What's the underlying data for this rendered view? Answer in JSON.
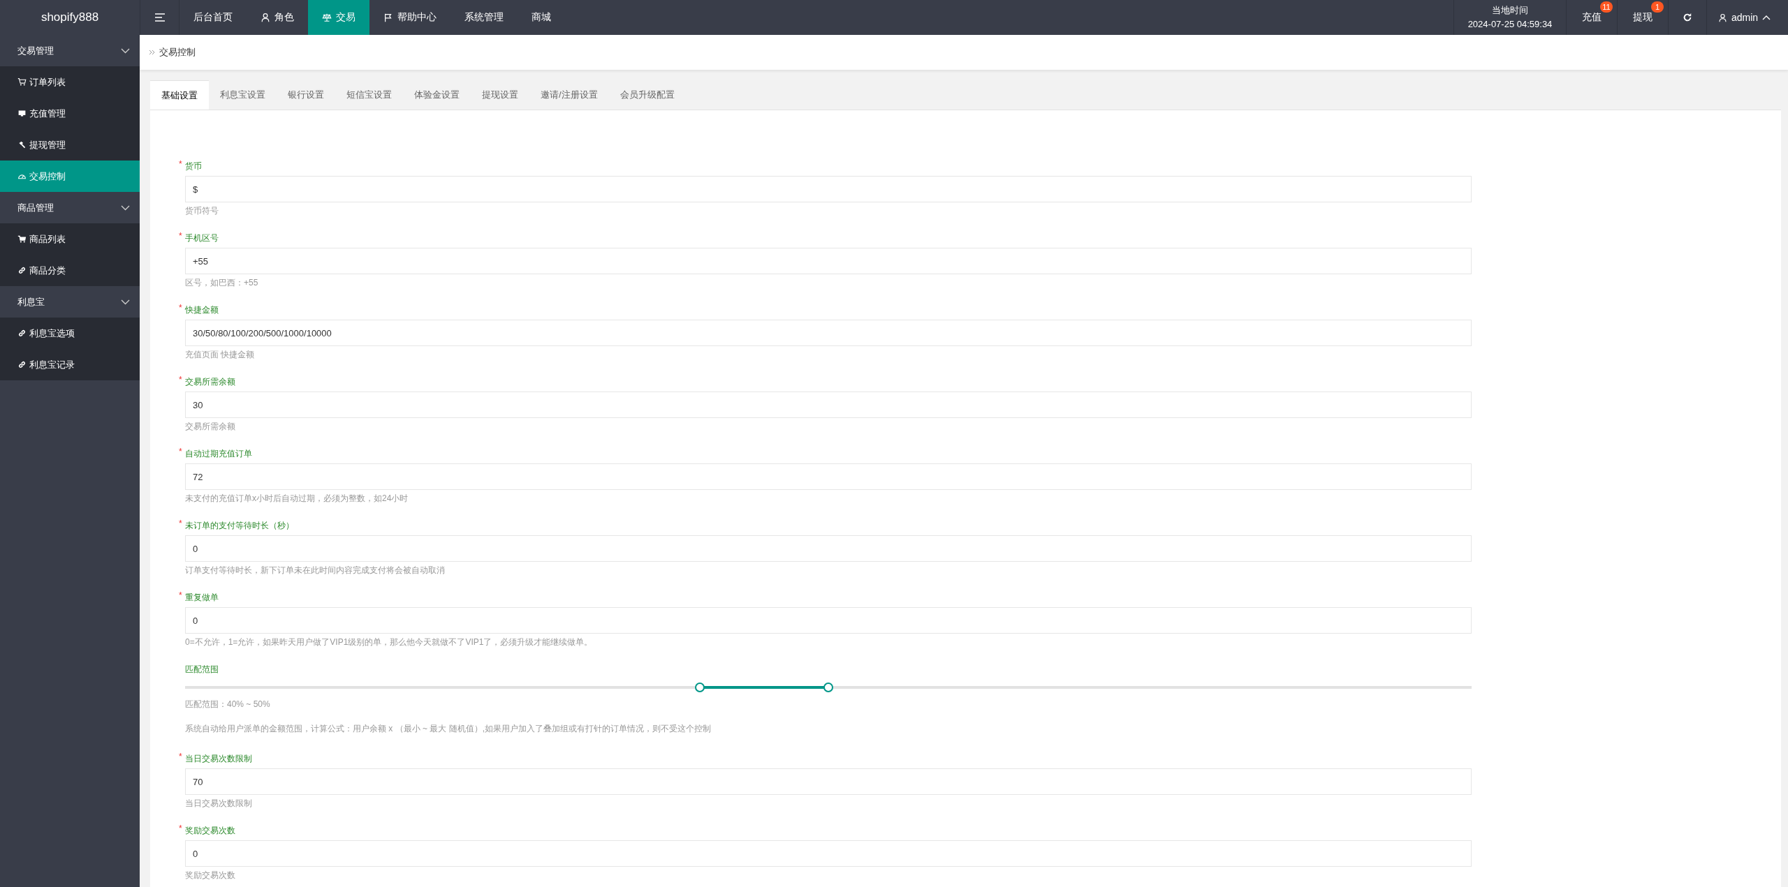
{
  "topbar": {
    "logo": "shopify888",
    "nav": [
      {
        "label": "后台首页",
        "selected": false
      },
      {
        "label": "角色",
        "selected": false
      },
      {
        "label": "交易",
        "selected": true
      },
      {
        "label": "帮助中心",
        "selected": false
      },
      {
        "label": "系统管理",
        "selected": false
      },
      {
        "label": "商城",
        "selected": false
      }
    ],
    "clock": {
      "label": "当地时间",
      "time": "2024-07-25 04:59:34"
    },
    "actions": [
      {
        "label": "充值",
        "badge": "11"
      },
      {
        "label": "提现",
        "badge": "1"
      }
    ],
    "user": {
      "name": "admin"
    }
  },
  "sidebar": {
    "groups": [
      {
        "label": "交易管理",
        "expanded": true,
        "items": [
          {
            "label": "订单列表",
            "selected": false
          },
          {
            "label": "充值管理",
            "selected": false
          },
          {
            "label": "提现管理",
            "selected": false
          },
          {
            "label": "交易控制",
            "selected": true
          }
        ]
      },
      {
        "label": "商品管理",
        "expanded": true,
        "items": [
          {
            "label": "商品列表",
            "selected": false
          },
          {
            "label": "商品分类",
            "selected": false
          }
        ]
      },
      {
        "label": "利息宝",
        "expanded": true,
        "items": [
          {
            "label": "利息宝选项",
            "selected": false
          },
          {
            "label": "利息宝记录",
            "selected": false
          }
        ]
      }
    ]
  },
  "breadcrumb": {
    "current": "交易控制"
  },
  "tabs": [
    {
      "label": "基础设置",
      "selected": true
    },
    {
      "label": "利息宝设置",
      "selected": false
    },
    {
      "label": "银行设置",
      "selected": false
    },
    {
      "label": "短信宝设置",
      "selected": false
    },
    {
      "label": "体验金设置",
      "selected": false
    },
    {
      "label": "提现设置",
      "selected": false
    },
    {
      "label": "邀请/注册设置",
      "selected": false
    },
    {
      "label": "会员升级配置",
      "selected": false
    }
  ],
  "form": {
    "fields": [
      {
        "kind": "input",
        "required_mark": "*",
        "label": "货币",
        "value": "$",
        "hint": "货币符号"
      },
      {
        "kind": "input",
        "required_mark": "*",
        "label": "手机区号",
        "value": "+55",
        "hint": "区号，如巴西：+55"
      },
      {
        "kind": "input",
        "required_mark": "*",
        "label": "快捷金额",
        "value": "30/50/80/100/200/500/1000/10000",
        "hint": "充值页面 快捷金额"
      },
      {
        "kind": "input",
        "required_mark": "*",
        "label": "交易所需余额",
        "value": "30",
        "hint": "交易所需余额"
      },
      {
        "kind": "input",
        "required_mark": "*",
        "label": "自动过期充值订单",
        "value": "72",
        "hint": "未支付的充值订单x小时后自动过期，必须为整数，如24小时"
      },
      {
        "kind": "input",
        "required_mark": "*",
        "label": "未订单的支付等待时长（秒）",
        "value": "0",
        "hint": "订单支付等待时长，新下订单未在此时间内容完成支付将会被自动取消"
      },
      {
        "kind": "input",
        "required_mark": "*",
        "label": "重复做单",
        "value": "0",
        "hint": "0=不允许，1=允许，如果昨天用户做了VIP1级别的单，那么他今天就做不了VIP1了，必须升级才能继续做单。"
      },
      {
        "kind": "range",
        "label": "匹配范围",
        "thumbs": [
          {
            "level": 0.4
          },
          {
            "level": 0.5
          }
        ],
        "reading": "匹配范围：40% ~ 50%",
        "hint": "系统自动给用户派单的金额范围，计算公式：用户余额 x （最小 ~ 最大 随机值）,如果用户加入了叠加组或有打针的订单情况，则不受这个控制"
      },
      {
        "kind": "input",
        "required_mark": "*",
        "label": "当日交易次数限制",
        "value": "70",
        "hint": "当日交易次数限制"
      },
      {
        "kind": "input",
        "required_mark": "*",
        "label": "奖励交易次数",
        "value": "0",
        "hint": "奖励交易次数"
      }
    ]
  }
}
